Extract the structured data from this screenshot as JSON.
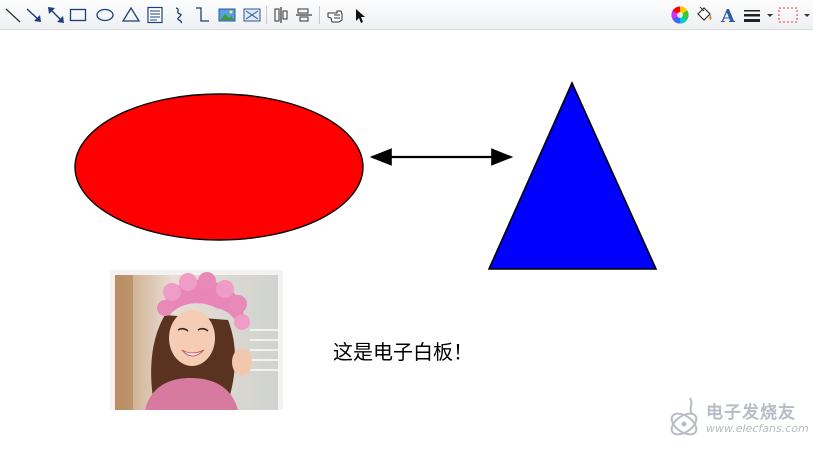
{
  "toolbar": {
    "tools": [
      {
        "id": "line",
        "icon": "line-icon"
      },
      {
        "id": "arrow-line",
        "icon": "arrow-line-icon"
      },
      {
        "id": "double-arrow",
        "icon": "double-arrow-icon"
      },
      {
        "id": "rectangle",
        "icon": "rectangle-icon"
      },
      {
        "id": "ellipse",
        "icon": "ellipse-icon"
      },
      {
        "id": "triangle",
        "icon": "triangle-icon"
      },
      {
        "id": "text-box",
        "icon": "text-box-icon"
      },
      {
        "id": "freehand",
        "icon": "freehand-icon"
      },
      {
        "id": "elbow-connector",
        "icon": "elbow-connector-icon"
      },
      {
        "id": "insert-image",
        "icon": "image-icon"
      },
      {
        "id": "insert-object",
        "icon": "object-icon"
      },
      {
        "id": "align-horizontal",
        "icon": "align-horizontal-icon"
      },
      {
        "id": "align-vertical",
        "icon": "align-vertical-icon"
      },
      {
        "id": "hand",
        "icon": "hand-icon"
      },
      {
        "id": "pointer",
        "icon": "pointer-icon"
      }
    ],
    "right_tools": [
      {
        "id": "color-picker",
        "icon": "color-wheel-icon"
      },
      {
        "id": "fill",
        "icon": "paint-bucket-icon"
      },
      {
        "id": "font",
        "icon": "font-icon",
        "glyph": "A"
      },
      {
        "id": "line-width",
        "icon": "line-width-icon"
      },
      {
        "id": "line-style",
        "icon": "dashed-rect-icon"
      }
    ]
  },
  "canvas": {
    "shapes": {
      "ellipse": {
        "fill": "#ff0000",
        "stroke": "#000000"
      },
      "triangle": {
        "fill": "#0000ff",
        "stroke": "#000000"
      },
      "arrow": {
        "stroke": "#000000",
        "style": "double-headed"
      }
    },
    "text": "这是电子白板！"
  },
  "watermark": {
    "logo": "electrons-logo",
    "cn": "电子发烧友",
    "url": "www.elecfans.com"
  }
}
